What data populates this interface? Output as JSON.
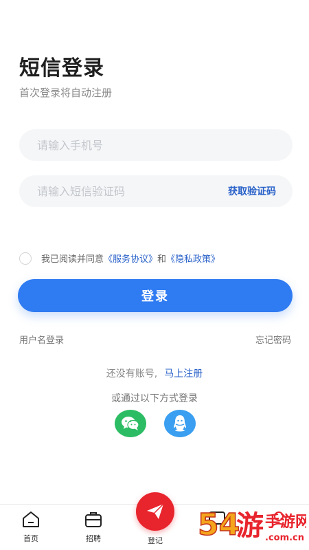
{
  "header": {
    "title": "短信登录",
    "subtitle": "首次登录将自动注册"
  },
  "form": {
    "phone_placeholder": "请输入手机号",
    "code_placeholder": "请输入短信验证码",
    "get_code_label": "获取验证码"
  },
  "agreement": {
    "prefix": "我已阅读并同意",
    "service_link": "《服务协议》",
    "and": "和",
    "privacy_link": "《隐私政策》"
  },
  "login_button_label": "登录",
  "links": {
    "username_login": "用户名登录",
    "forgot_password": "忘记密码"
  },
  "register": {
    "prompt": "还没有账号,",
    "link": "马上注册"
  },
  "alt_login_label": "或通过以下方式登录",
  "social": [
    {
      "icon": "wechat-icon",
      "color": "#2cbc63"
    },
    {
      "icon": "qq-icon",
      "color": "#3a9ff0"
    }
  ],
  "tabbar": {
    "items": [
      {
        "label": "首页",
        "icon": "home-icon"
      },
      {
        "label": "招聘",
        "icon": "briefcase-icon"
      },
      {
        "label": "登记",
        "icon": "paper-plane-icon"
      },
      {
        "label": "",
        "icon": "message-icon"
      },
      {
        "label": "",
        "icon": "user-icon"
      }
    ]
  },
  "colors": {
    "primary": "#2f7bf2",
    "link": "#2a62c9",
    "accent_red": "#e8242d"
  },
  "watermark": "54游手游网 .com.cn"
}
